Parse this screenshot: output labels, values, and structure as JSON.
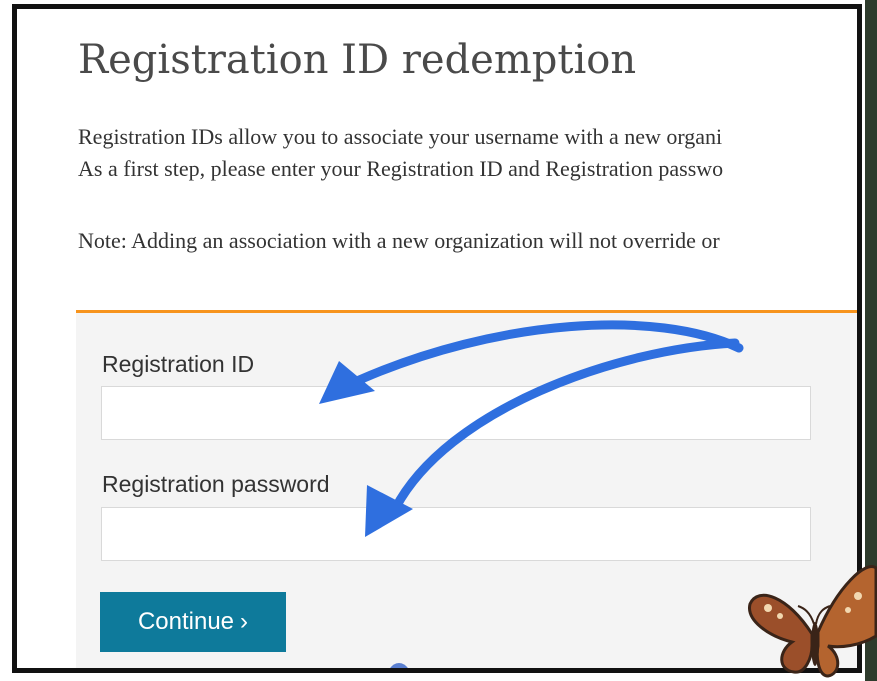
{
  "page": {
    "title": "Registration ID redemption",
    "paragraph_1": "Registration IDs allow you to associate your username with a new organi\nAs a first step, please enter your Registration ID and Registration passwo",
    "paragraph_2": "Note: Adding an association with a new organization will not override or"
  },
  "form": {
    "registration_id": {
      "label": "Registration ID",
      "value": ""
    },
    "registration_password": {
      "label": "Registration password",
      "value": ""
    },
    "continue_button": {
      "label": "Continue",
      "icon": "chevron-right-icon"
    }
  },
  "colors": {
    "accent_orange": "#f7941d",
    "button_teal": "#0e7a9b",
    "annotation_arrow": "#2f6fdf"
  },
  "decorations": {
    "annotation_arrows": [
      "arrow-to-registration-id",
      "arrow-to-registration-password"
    ],
    "butterfly": "butterfly-illustration",
    "flower": "blue-flower-illustration"
  }
}
